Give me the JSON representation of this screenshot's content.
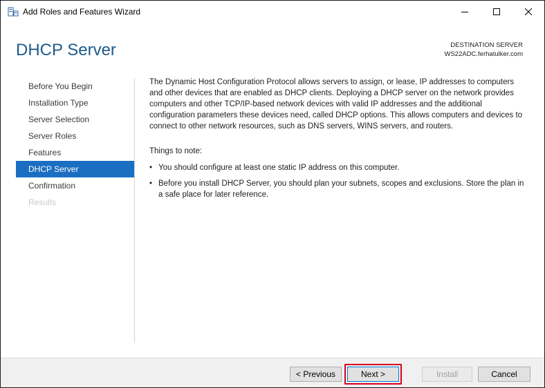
{
  "window": {
    "title": "Add Roles and Features Wizard",
    "icon": "server-manager-icon"
  },
  "header": {
    "page_title": "DHCP Server",
    "destination_label": "DESTINATION SERVER",
    "destination_server": "WS22ADC.ferhatulker.com"
  },
  "nav": {
    "items": [
      {
        "label": "Before You Begin",
        "state": "normal"
      },
      {
        "label": "Installation Type",
        "state": "normal"
      },
      {
        "label": "Server Selection",
        "state": "normal"
      },
      {
        "label": "Server Roles",
        "state": "normal"
      },
      {
        "label": "Features",
        "state": "normal"
      },
      {
        "label": "DHCP Server",
        "state": "active"
      },
      {
        "label": "Confirmation",
        "state": "normal"
      },
      {
        "label": "Results",
        "state": "disabled"
      }
    ]
  },
  "content": {
    "intro": "The Dynamic Host Configuration Protocol allows servers to assign, or lease, IP addresses to computers and other devices that are enabled as DHCP clients. Deploying a DHCP server on the network provides computers and other TCP/IP-based network devices with valid IP addresses and the additional configuration parameters these devices need, called DHCP options. This allows computers and devices to connect to other network resources, such as DNS servers, WINS servers, and routers.",
    "notes_heading": "Things to note:",
    "notes": [
      "You should configure at least one static IP address on this computer.",
      "Before you install DHCP Server, you should plan your subnets, scopes and exclusions. Store the plan in a safe place for later reference."
    ]
  },
  "footer": {
    "previous_label": "< Previous",
    "next_label": "Next >",
    "install_label": "Install",
    "cancel_label": "Cancel"
  },
  "colors": {
    "title_accent": "#1e5a8a",
    "nav_active_bg": "#1b6fc2",
    "highlight_border": "#d7001e"
  }
}
